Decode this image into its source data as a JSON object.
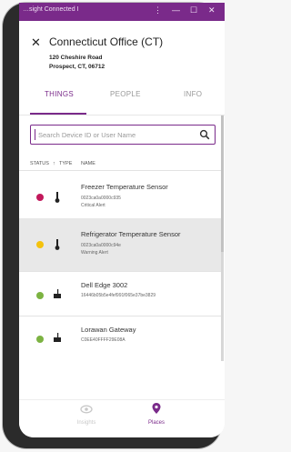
{
  "window": {
    "title": "…sight Connected I",
    "controls": [
      "⋮",
      "—",
      "☐",
      "✕"
    ]
  },
  "header": {
    "close_glyph": "✕",
    "title": "Connecticut Office (CT)",
    "address_line1": "120 Cheshire Road",
    "address_line2": "Prospect, CT, 06712"
  },
  "tabs": [
    {
      "label": "THINGS",
      "active": true
    },
    {
      "label": "PEOPLE",
      "active": false
    },
    {
      "label": "INFO",
      "active": false
    }
  ],
  "search": {
    "placeholder": "Search Device ID or User Name",
    "icon": "search-icon"
  },
  "columns": {
    "status": "STATUS",
    "type": "TYPE",
    "name": "NAME",
    "sort_arrow": "↑"
  },
  "devices": [
    {
      "status_color": "#c2185b",
      "type_icon": "thermometer-icon",
      "name": "Freezer Temperature Sensor",
      "id": "0023ca0a0000c935",
      "detail": "Critical Alert",
      "selected": false
    },
    {
      "status_color": "#f4c20d",
      "type_icon": "thermometer-icon",
      "name": "Refrigerator Temperature Sensor",
      "id": "0023ca0a0000c94e",
      "detail": "Warning Alert",
      "selected": true
    },
    {
      "status_color": "#7cb342",
      "type_icon": "router-icon",
      "name": "Dell Edge 3002",
      "id": "16446b05b5e4fef991f065e37be3829",
      "detail": "",
      "selected": false
    },
    {
      "status_color": "#7cb342",
      "type_icon": "router-icon",
      "name": "Lorawan Gateway",
      "id": "C0EE40FFFF29E08A",
      "detail": "",
      "selected": false
    }
  ],
  "nav": [
    {
      "label": "Insights",
      "icon": "eye-icon",
      "active": false
    },
    {
      "label": "Places",
      "icon": "location-pin-icon",
      "active": true
    }
  ],
  "colors": {
    "accent": "#7a2a8a",
    "inactive": "#bdbdbd"
  }
}
